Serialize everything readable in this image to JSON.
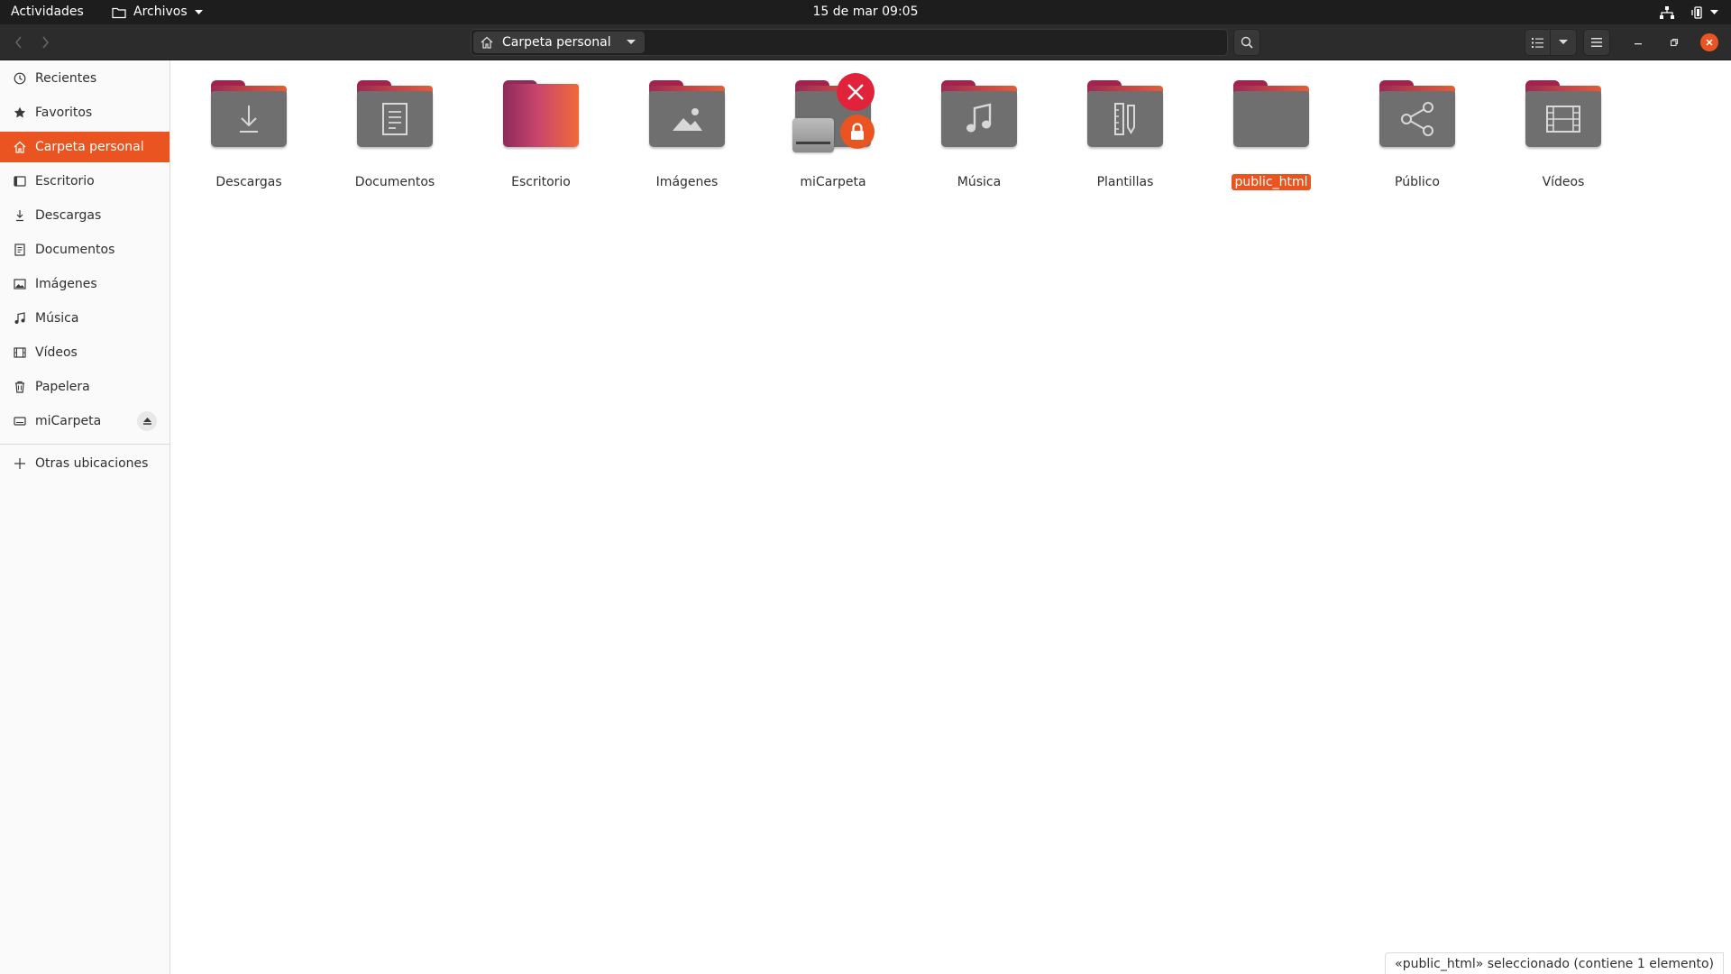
{
  "topbar": {
    "activities": "Actividades",
    "app_name": "Archivos",
    "clock": "15 de mar  09:05"
  },
  "header": {
    "location": "Carpeta personal",
    "icons": [
      "back-icon",
      "forward-icon",
      "home-icon",
      "search-icon",
      "list-view-icon",
      "menu-icon",
      "minimize-icon",
      "maximize-icon",
      "close-icon"
    ]
  },
  "sidebar": {
    "items": [
      {
        "label": "Recientes",
        "icon": "clock-icon"
      },
      {
        "label": "Favoritos",
        "icon": "star-icon"
      },
      {
        "label": "Carpeta personal",
        "icon": "home-icon"
      },
      {
        "label": "Escritorio",
        "icon": "desktop-icon"
      },
      {
        "label": "Descargas",
        "icon": "download-icon"
      },
      {
        "label": "Documentos",
        "icon": "document-icon"
      },
      {
        "label": "Imágenes",
        "icon": "image-icon"
      },
      {
        "label": "Música",
        "icon": "music-icon"
      },
      {
        "label": "Vídeos",
        "icon": "video-icon"
      },
      {
        "label": "Papelera",
        "icon": "trash-icon"
      },
      {
        "label": "miCarpeta",
        "icon": "drive-icon"
      }
    ],
    "other_locations": "Otras ubicaciones"
  },
  "files": [
    {
      "name": "Descargas",
      "icon": "download-icon"
    },
    {
      "name": "Documentos",
      "icon": "document-icon"
    },
    {
      "name": "Escritorio",
      "icon": "desktop-icon"
    },
    {
      "name": "Imágenes",
      "icon": "image-icon"
    },
    {
      "name": "miCarpeta",
      "icon": "drive-icon"
    },
    {
      "name": "Música",
      "icon": "music-icon"
    },
    {
      "name": "Plantillas",
      "icon": "template-icon"
    },
    {
      "name": "public_html",
      "icon": "folder-icon"
    },
    {
      "name": "Público",
      "icon": "share-icon"
    },
    {
      "name": "Vídeos",
      "icon": "video-icon"
    }
  ],
  "status": {
    "text": "«public_html» seleccionado  (contiene 1 elemento)"
  },
  "colors": {
    "accent": "#e95420",
    "topbar": "#1d1d1d",
    "headerbar": "#2c2c2c"
  }
}
